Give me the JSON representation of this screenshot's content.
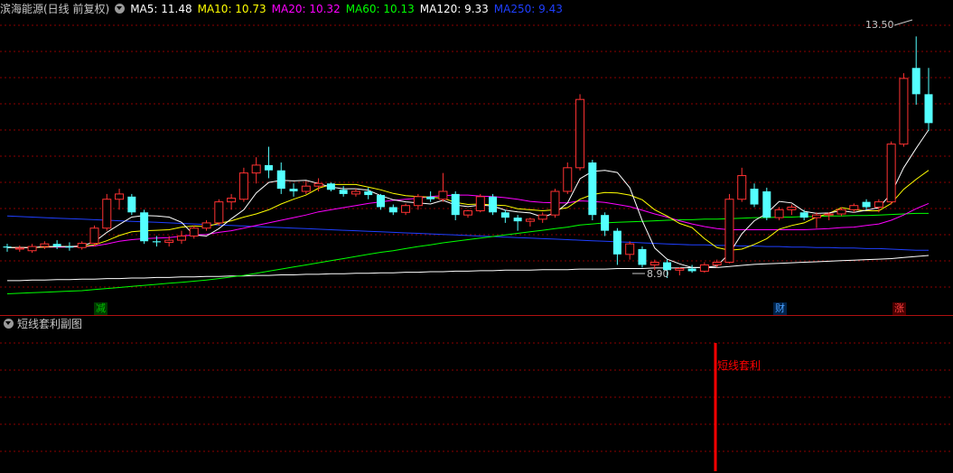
{
  "header": {
    "title": "滨海能源(日线 前复权)",
    "ma5": {
      "label": "MA5: 11.48",
      "color": "#ffffff"
    },
    "ma10": {
      "label": "MA10: 10.73",
      "color": "#ffff00"
    },
    "ma20": {
      "label": "MA20: 10.32",
      "color": "#ff00ff"
    },
    "ma60": {
      "label": "MA60: 10.13",
      "color": "#00ff00"
    },
    "ma120": {
      "label": "MA120: 9.33",
      "color": "#ffffff"
    },
    "ma250": {
      "label": "MA250: 9.43",
      "color": "#1f3fff"
    }
  },
  "annotations": {
    "high": "13.50",
    "low": "8.90"
  },
  "markers": {
    "jian": "减",
    "cai": "财",
    "zhang": "涨"
  },
  "sub_panel": {
    "title": "短线套利副图",
    "signal_label": "短线套利",
    "signal_color": "#ff0000"
  },
  "chart_data": {
    "type": "candlestick",
    "ohlc": [
      [
        9.5,
        9.55,
        9.4,
        9.48
      ],
      [
        9.45,
        9.52,
        9.4,
        9.47
      ],
      [
        9.42,
        9.55,
        9.38,
        9.5
      ],
      [
        9.5,
        9.6,
        9.45,
        9.55
      ],
      [
        9.55,
        9.62,
        9.45,
        9.5
      ],
      [
        9.5,
        9.58,
        9.42,
        9.48
      ],
      [
        9.48,
        9.6,
        9.44,
        9.56
      ],
      [
        9.56,
        9.9,
        9.5,
        9.85
      ],
      [
        9.85,
        10.5,
        9.8,
        10.4
      ],
      [
        10.4,
        10.6,
        10.2,
        10.5
      ],
      [
        10.45,
        10.5,
        10.1,
        10.15
      ],
      [
        10.15,
        10.2,
        9.55,
        9.6
      ],
      [
        9.6,
        9.7,
        9.5,
        9.58
      ],
      [
        9.58,
        9.7,
        9.5,
        9.62
      ],
      [
        9.62,
        9.8,
        9.55,
        9.7
      ],
      [
        9.7,
        9.9,
        9.65,
        9.85
      ],
      [
        9.85,
        10.0,
        9.8,
        9.95
      ],
      [
        9.95,
        10.4,
        9.9,
        10.35
      ],
      [
        10.35,
        10.5,
        10.2,
        10.42
      ],
      [
        10.4,
        11.0,
        10.35,
        10.9
      ],
      [
        10.9,
        11.2,
        10.7,
        11.05
      ],
      [
        11.05,
        11.4,
        10.8,
        10.95
      ],
      [
        10.95,
        11.1,
        10.5,
        10.6
      ],
      [
        10.6,
        10.7,
        10.45,
        10.55
      ],
      [
        10.55,
        10.75,
        10.5,
        10.65
      ],
      [
        10.65,
        10.8,
        10.55,
        10.7
      ],
      [
        10.7,
        10.72,
        10.55,
        10.58
      ],
      [
        10.58,
        10.65,
        10.45,
        10.5
      ],
      [
        10.5,
        10.6,
        10.45,
        10.55
      ],
      [
        10.55,
        10.62,
        10.4,
        10.48
      ],
      [
        10.48,
        10.5,
        10.2,
        10.25
      ],
      [
        10.25,
        10.3,
        10.1,
        10.15
      ],
      [
        10.15,
        10.32,
        10.1,
        10.28
      ],
      [
        10.28,
        10.5,
        10.2,
        10.45
      ],
      [
        10.45,
        10.55,
        10.35,
        10.4
      ],
      [
        10.4,
        10.9,
        10.35,
        10.55
      ],
      [
        10.5,
        10.55,
        10.0,
        10.1
      ],
      [
        10.1,
        10.2,
        10.05,
        10.18
      ],
      [
        10.18,
        10.5,
        10.15,
        10.45
      ],
      [
        10.45,
        10.5,
        10.1,
        10.15
      ],
      [
        10.15,
        10.2,
        9.95,
        10.05
      ],
      [
        10.05,
        10.1,
        9.8,
        9.98
      ],
      [
        9.98,
        10.05,
        9.88,
        10.02
      ],
      [
        10.02,
        10.15,
        9.95,
        10.1
      ],
      [
        10.1,
        10.6,
        10.05,
        10.55
      ],
      [
        10.55,
        11.1,
        10.5,
        11.0
      ],
      [
        11.0,
        12.4,
        10.95,
        12.3
      ],
      [
        11.1,
        11.15,
        10.0,
        10.1
      ],
      [
        10.1,
        10.15,
        9.7,
        9.8
      ],
      [
        9.8,
        9.85,
        9.15,
        9.35
      ],
      [
        9.35,
        9.6,
        9.25,
        9.55
      ],
      [
        9.45,
        9.5,
        9.1,
        9.15
      ],
      [
        9.15,
        9.25,
        9.05,
        9.2
      ],
      [
        9.2,
        9.25,
        8.9,
        9.05
      ],
      [
        9.05,
        9.1,
        8.95,
        9.08
      ],
      [
        9.08,
        9.15,
        9.0,
        9.03
      ],
      [
        9.03,
        9.2,
        9.0,
        9.15
      ],
      [
        9.15,
        9.25,
        9.1,
        9.2
      ],
      [
        9.2,
        10.5,
        9.18,
        10.4
      ],
      [
        10.4,
        11.0,
        10.35,
        10.85
      ],
      [
        10.6,
        10.7,
        10.25,
        10.3
      ],
      [
        10.55,
        10.62,
        10.0,
        10.05
      ],
      [
        10.05,
        10.25,
        10.0,
        10.2
      ],
      [
        10.2,
        10.3,
        10.1,
        10.25
      ],
      [
        10.15,
        10.2,
        10.0,
        10.05
      ],
      [
        10.05,
        10.15,
        9.85,
        10.1
      ],
      [
        10.1,
        10.15,
        10.0,
        10.12
      ],
      [
        10.12,
        10.25,
        10.08,
        10.2
      ],
      [
        10.2,
        10.32,
        10.15,
        10.28
      ],
      [
        10.35,
        10.4,
        10.2,
        10.25
      ],
      [
        10.25,
        10.4,
        10.15,
        10.35
      ],
      [
        10.35,
        11.5,
        10.3,
        11.45
      ],
      [
        11.45,
        12.8,
        11.4,
        12.7
      ],
      [
        12.9,
        13.5,
        12.2,
        12.4
      ],
      [
        12.4,
        12.9,
        11.7,
        11.85
      ]
    ],
    "ma5": [
      9.48,
      9.48,
      9.48,
      9.5,
      9.5,
      9.5,
      9.51,
      9.59,
      9.77,
      9.92,
      10.06,
      10.09,
      10.08,
      10.06,
      9.96,
      9.72,
      9.7,
      9.84,
      10.03,
      10.2,
      10.52,
      10.72,
      10.76,
      10.75,
      10.76,
      10.7,
      10.63,
      10.6,
      10.6,
      10.57,
      10.47,
      10.39,
      10.35,
      10.33,
      10.31,
      10.38,
      10.29,
      10.26,
      10.29,
      10.27,
      10.19,
      10.16,
      10.14,
      10.06,
      10.14,
      10.33,
      10.79,
      10.93,
      10.95,
      10.91,
      10.62,
      9.99,
      9.47,
      9.26,
      9.17,
      9.1,
      9.1,
      9.13,
      9.37,
      9.74,
      9.99,
      10.13,
      10.36,
      10.33,
      10.17,
      10.13,
      10.14,
      10.18,
      10.15,
      10.19,
      10.24,
      10.51,
      11.0,
      11.37,
      11.72
    ],
    "ma10": [
      9.48,
      9.48,
      9.48,
      9.49,
      9.5,
      9.5,
      9.5,
      9.53,
      9.61,
      9.71,
      9.78,
      9.8,
      9.81,
      9.82,
      9.87,
      9.89,
      9.88,
      9.94,
      9.99,
      10.06,
      10.12,
      10.2,
      10.31,
      10.4,
      10.48,
      10.61,
      10.68,
      10.68,
      10.68,
      10.63,
      10.58,
      10.51,
      10.47,
      10.45,
      10.44,
      10.42,
      10.34,
      10.3,
      10.31,
      10.29,
      10.28,
      10.22,
      10.2,
      10.18,
      10.2,
      10.24,
      10.4,
      10.49,
      10.53,
      10.52,
      10.48,
      10.39,
      10.2,
      10.08,
      9.94,
      9.86,
      9.65,
      9.48,
      9.43,
      9.45,
      9.54,
      9.65,
      9.83,
      9.9,
      9.95,
      10.06,
      10.13,
      10.24,
      10.2,
      10.18,
      10.18,
      10.32,
      10.59,
      10.78,
      10.95
    ],
    "ma20": [
      9.48,
      9.48,
      9.48,
      9.49,
      9.49,
      9.49,
      9.5,
      9.51,
      9.55,
      9.6,
      9.63,
      9.65,
      9.66,
      9.67,
      9.7,
      9.72,
      9.73,
      9.77,
      9.8,
      9.85,
      9.9,
      9.95,
      10.0,
      10.05,
      10.1,
      10.16,
      10.2,
      10.24,
      10.28,
      10.32,
      10.35,
      10.38,
      10.4,
      10.42,
      10.45,
      10.47,
      10.48,
      10.48,
      10.46,
      10.45,
      10.43,
      10.4,
      10.36,
      10.34,
      10.33,
      10.33,
      10.37,
      10.36,
      10.34,
      10.3,
      10.26,
      10.19,
      10.12,
      10.06,
      9.99,
      9.93,
      9.88,
      9.84,
      9.82,
      9.82,
      9.82,
      9.82,
      9.82,
      9.82,
      9.82,
      9.83,
      9.84,
      9.86,
      9.87,
      9.9,
      9.93,
      10.0,
      10.1,
      10.22,
      10.32
    ],
    "ma60": [
      8.6,
      8.61,
      8.62,
      8.63,
      8.64,
      8.65,
      8.66,
      8.68,
      8.7,
      8.72,
      8.74,
      8.76,
      8.78,
      8.8,
      8.82,
      8.84,
      8.86,
      8.89,
      8.92,
      8.95,
      8.99,
      9.03,
      9.07,
      9.11,
      9.15,
      9.19,
      9.23,
      9.27,
      9.31,
      9.35,
      9.39,
      9.42,
      9.46,
      9.5,
      9.53,
      9.57,
      9.6,
      9.63,
      9.66,
      9.69,
      9.72,
      9.75,
      9.78,
      9.81,
      9.84,
      9.87,
      9.91,
      9.93,
      9.95,
      9.96,
      9.97,
      9.98,
      9.99,
      10.0,
      10.01,
      10.01,
      10.02,
      10.02,
      10.03,
      10.04,
      10.05,
      10.05,
      10.06,
      10.06,
      10.07,
      10.07,
      10.08,
      10.08,
      10.09,
      10.09,
      10.1,
      10.11,
      10.12,
      10.13,
      10.13
    ],
    "ma120": [
      8.85,
      8.85,
      8.86,
      8.86,
      8.87,
      8.87,
      8.88,
      8.88,
      8.89,
      8.89,
      8.9,
      8.9,
      8.91,
      8.91,
      8.92,
      8.92,
      8.93,
      8.93,
      8.94,
      8.94,
      8.95,
      8.95,
      8.96,
      8.96,
      8.97,
      8.97,
      8.98,
      8.98,
      8.99,
      8.99,
      9.0,
      9.0,
      9.01,
      9.01,
      9.02,
      9.02,
      9.03,
      9.03,
      9.04,
      9.04,
      9.05,
      9.05,
      9.05,
      9.06,
      9.06,
      9.06,
      9.07,
      9.07,
      9.07,
      9.08,
      9.08,
      9.08,
      9.09,
      9.09,
      9.09,
      9.1,
      9.1,
      9.1,
      9.12,
      9.14,
      9.16,
      9.17,
      9.18,
      9.19,
      9.2,
      9.21,
      9.22,
      9.23,
      9.24,
      9.25,
      9.26,
      9.27,
      9.29,
      9.31,
      9.33
    ],
    "ma250": [
      10.08,
      10.07,
      10.06,
      10.05,
      10.04,
      10.03,
      10.02,
      10.01,
      10.0,
      9.99,
      9.98,
      9.97,
      9.96,
      9.95,
      9.94,
      9.93,
      9.92,
      9.91,
      9.9,
      9.89,
      9.88,
      9.87,
      9.86,
      9.85,
      9.84,
      9.83,
      9.82,
      9.81,
      9.8,
      9.79,
      9.78,
      9.77,
      9.76,
      9.75,
      9.74,
      9.73,
      9.72,
      9.71,
      9.7,
      9.69,
      9.68,
      9.67,
      9.66,
      9.65,
      9.64,
      9.63,
      9.62,
      9.61,
      9.6,
      9.59,
      9.58,
      9.57,
      9.56,
      9.55,
      9.54,
      9.53,
      9.53,
      9.52,
      9.52,
      9.51,
      9.51,
      9.5,
      9.5,
      9.49,
      9.49,
      9.48,
      9.48,
      9.47,
      9.47,
      9.46,
      9.46,
      9.45,
      9.44,
      9.43,
      9.43
    ],
    "price_min": 8.35,
    "price_max": 13.85,
    "signal_index": 58
  },
  "colors": {
    "up": "#ff3232",
    "down": "#54ffff",
    "grid": "#8b0000",
    "marker_green": "#00c000",
    "marker_blue": "#4aa0ff",
    "marker_red": "#ff4040"
  }
}
